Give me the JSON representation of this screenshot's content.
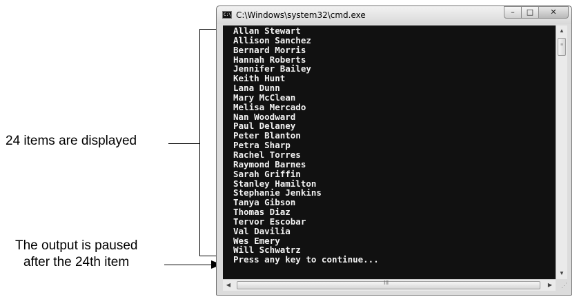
{
  "annotations": {
    "items_label": "24 items are displayed",
    "paused_label_line1": "The output is paused",
    "paused_label_line2": "after the 24th item"
  },
  "window": {
    "title": "C:\\Windows\\system32\\cmd.exe",
    "app_icon": "cmd-icon",
    "app_icon_text": "C:\\",
    "controls": {
      "minimize_icon": "minimize-icon",
      "maximize_icon": "maximize-icon",
      "close_icon": "close-icon"
    }
  },
  "console": {
    "lines": [
      "Allan Stewart",
      "Allison Sanchez",
      "Bernard Morris",
      "Hannah Roberts",
      "Jennifer Bailey",
      "Keith Hunt",
      "Lana Dunn",
      "Mary McClean",
      "Melisa Mercado",
      "Nan Woodward",
      "Paul Delaney",
      "Peter Blanton",
      "Petra Sharp",
      "Rachel Torres",
      "Raymond Barnes",
      "Sarah Griffin",
      "Stanley Hamilton",
      "Stephanie Jenkins",
      "Tanya Gibson",
      "Thomas Diaz",
      "Tervor Escobar",
      "Val Davilia",
      "Wes Emery",
      "Will Schwatrz",
      "Press any key to continue..."
    ],
    "background": "#111111",
    "foreground": "#f2f2f2"
  },
  "scrollbars": {
    "vertical": {
      "up_icon": "scroll-up-arrow-icon",
      "down_icon": "scroll-down-arrow-icon"
    },
    "horizontal": {
      "left_icon": "scroll-left-arrow-icon",
      "right_icon": "scroll-right-arrow-icon",
      "grip_text": "III"
    }
  }
}
